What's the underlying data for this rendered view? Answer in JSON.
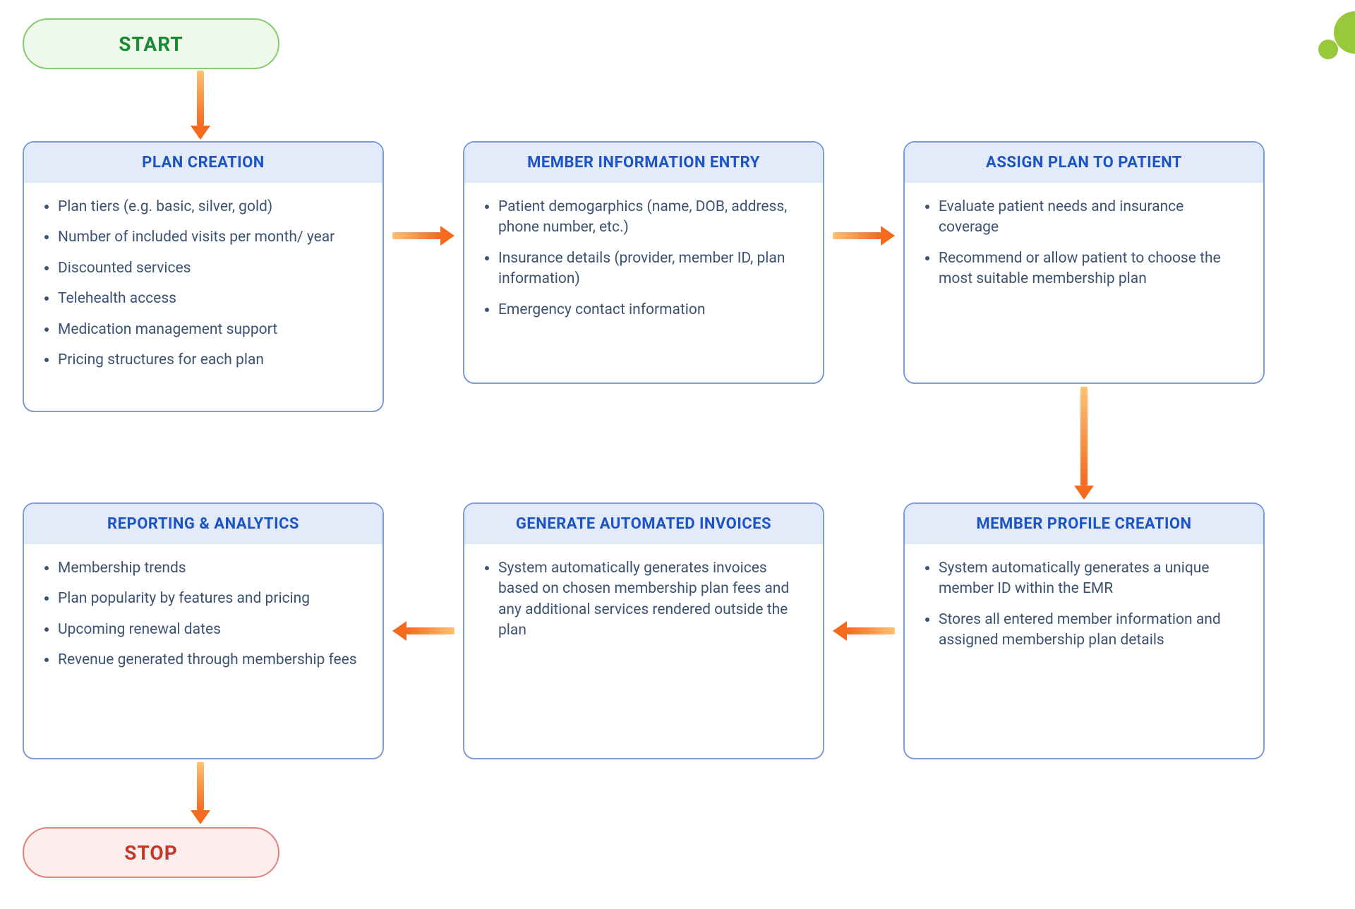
{
  "terminals": {
    "start": "START",
    "stop": "STOP"
  },
  "cards": {
    "plan_creation": {
      "title": "PLAN CREATION",
      "items": [
        "Plan tiers (e.g. basic, silver, gold)",
        "Number of included visits per month/ year",
        "Discounted services",
        "Telehealth access",
        "Medication management support",
        "Pricing structures for each plan"
      ]
    },
    "member_info_entry": {
      "title": "MEMBER INFORMATION ENTRY",
      "items": [
        "Patient demogarphics (name, DOB, address, phone number, etc.)",
        "Insurance details (provider, member ID, plan information)",
        "Emergency contact information"
      ]
    },
    "assign_plan": {
      "title": "ASSIGN PLAN TO PATIENT",
      "items": [
        "Evaluate patient needs and insurance coverage",
        "Recommend or allow patient to choose the most suitable membership plan"
      ]
    },
    "member_profile": {
      "title": "MEMBER PROFILE CREATION",
      "items": [
        "System automatically generates a unique member ID within the EMR",
        "Stores all entered member information and assigned membership plan details"
      ]
    },
    "invoices": {
      "title": "GENERATE AUTOMATED INVOICES",
      "items": [
        "System automatically generates invoices based on chosen membership plan fees and any additional services rendered outside the plan"
      ]
    },
    "reporting": {
      "title": "REPORTING & ANALYTICS",
      "items": [
        "Membership trends",
        "Plan popularity by features and pricing",
        "Upcoming renewal dates",
        "Revenue generated through membership fees"
      ]
    }
  }
}
